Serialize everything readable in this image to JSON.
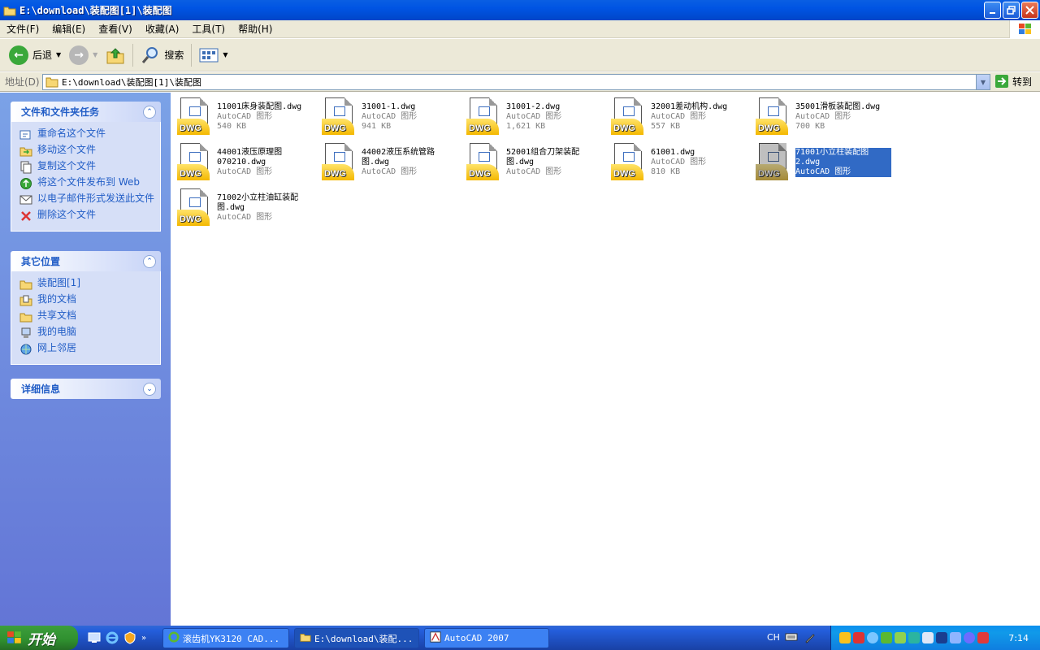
{
  "window": {
    "title": "E:\\download\\装配图[1]\\装配图"
  },
  "menu": [
    {
      "label": "文件(F)"
    },
    {
      "label": "编辑(E)"
    },
    {
      "label": "查看(V)"
    },
    {
      "label": "收藏(A)"
    },
    {
      "label": "工具(T)"
    },
    {
      "label": "帮助(H)"
    }
  ],
  "toolbar": {
    "back_label": "后退",
    "search_label": "搜索"
  },
  "address": {
    "label": "地址(D)",
    "value": "E:\\download\\装配图[1]\\装配图",
    "go_label": "转到"
  },
  "left_pane": {
    "tasks": {
      "title": "文件和文件夹任务",
      "items": [
        {
          "label": "重命名这个文件",
          "icon": "rename-icon"
        },
        {
          "label": "移动这个文件",
          "icon": "move-icon"
        },
        {
          "label": "复制这个文件",
          "icon": "copy-icon"
        },
        {
          "label": "将这个文件发布到 Web",
          "icon": "publish-web-icon"
        },
        {
          "label": "以电子邮件形式发送此文件",
          "icon": "email-icon"
        },
        {
          "label": "删除这个文件",
          "icon": "delete-icon"
        }
      ]
    },
    "other_places": {
      "title": "其它位置",
      "items": [
        {
          "label": "装配图[1]",
          "icon": "folder-icon"
        },
        {
          "label": "我的文档",
          "icon": "my-documents-icon"
        },
        {
          "label": "共享文档",
          "icon": "shared-folder-icon"
        },
        {
          "label": "我的电脑",
          "icon": "my-computer-icon"
        },
        {
          "label": "网上邻居",
          "icon": "network-icon"
        }
      ]
    },
    "details": {
      "title": "详细信息"
    }
  },
  "files": [
    {
      "name": "11001床身装配图.dwg",
      "type": "AutoCAD 图形",
      "size": "540 KB",
      "selected": false
    },
    {
      "name": "31001-1.dwg",
      "type": "AutoCAD 图形",
      "size": "941 KB",
      "selected": false
    },
    {
      "name": "31001-2.dwg",
      "type": "AutoCAD 图形",
      "size": "1,621 KB",
      "selected": false
    },
    {
      "name": "32001差动机构.dwg",
      "type": "AutoCAD 图形",
      "size": "557 KB",
      "selected": false
    },
    {
      "name": "35001滑板装配图.dwg",
      "type": "AutoCAD 图形",
      "size": "700 KB",
      "selected": false
    },
    {
      "name": "44001液压原理图070210.dwg",
      "type": "AutoCAD 图形",
      "size": "",
      "selected": false
    },
    {
      "name": "44002液压系统管路图.dwg",
      "type": "AutoCAD 图形",
      "size": "",
      "selected": false
    },
    {
      "name": "52001组合刀架装配图.dwg",
      "type": "AutoCAD 图形",
      "size": "",
      "selected": false
    },
    {
      "name": "61001.dwg",
      "type": "AutoCAD 图形",
      "size": "810 KB",
      "selected": false
    },
    {
      "name": "71001小立柱装配图2.dwg",
      "type": "AutoCAD 图形",
      "size": "",
      "selected": true
    },
    {
      "name": "71002小立柱油缸装配图.dwg",
      "type": "AutoCAD 图形",
      "size": "",
      "selected": false
    }
  ],
  "file_icon_label": "DWG",
  "taskbar": {
    "start_label": "开始",
    "buttons": [
      {
        "label": "滚齿机YK3120 CAD...",
        "icon": "ie-icon",
        "active": false
      },
      {
        "label": "E:\\download\\装配...",
        "icon": "folder-icon",
        "active": true
      },
      {
        "label": "AutoCAD 2007",
        "icon": "autocad-icon",
        "active": false
      }
    ],
    "lang": "CH",
    "clock": "7:14"
  },
  "colors": {
    "title_blue": "#0054e3",
    "link_blue": "#215dc6",
    "selection": "#316ac5",
    "dwg_yellow": "#f4b800"
  }
}
